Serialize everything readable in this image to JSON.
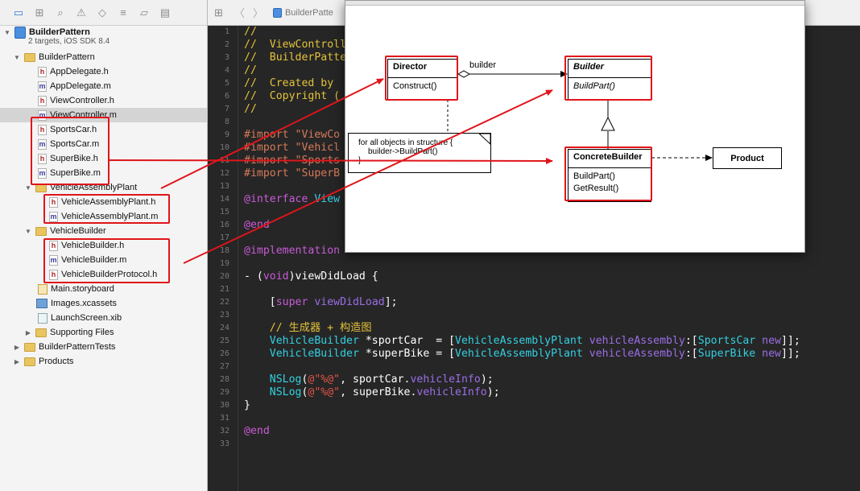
{
  "navigator": {
    "toolbar_icons": [
      "folder-icon",
      "symbol-icon",
      "search-icon",
      "warning-icon",
      "test-icon",
      "debug-icon",
      "breakpoint-icon",
      "log-icon"
    ],
    "project": {
      "name": "BuilderPattern",
      "subtitle": "2 targets, iOS SDK 8.4"
    },
    "items": [
      {
        "label": "BuilderPattern",
        "kind": "group"
      },
      {
        "label": "AppDelegate.h",
        "kind": "h"
      },
      {
        "label": "AppDelegate.m",
        "kind": "m"
      },
      {
        "label": "ViewController.h",
        "kind": "h"
      },
      {
        "label": "ViewController.m",
        "kind": "m"
      },
      {
        "label": "SportsCar.h",
        "kind": "h"
      },
      {
        "label": "SportsCar.m",
        "kind": "m"
      },
      {
        "label": "SuperBike.h",
        "kind": "h"
      },
      {
        "label": "SuperBike.m",
        "kind": "m"
      },
      {
        "label": "VehicleAssemblyPlant",
        "kind": "group"
      },
      {
        "label": "VehicleAssemblyPlant.h",
        "kind": "h"
      },
      {
        "label": "VehicleAssemblyPlant.m",
        "kind": "m"
      },
      {
        "label": "VehicleBuilder",
        "kind": "group"
      },
      {
        "label": "VehicleBuilder.h",
        "kind": "h"
      },
      {
        "label": "VehicleBuilder.m",
        "kind": "m"
      },
      {
        "label": "VehicleBuilderProtocol.h",
        "kind": "h"
      },
      {
        "label": "Main.storyboard",
        "kind": "storyboard"
      },
      {
        "label": "Images.xcassets",
        "kind": "xcassets"
      },
      {
        "label": "LaunchScreen.xib",
        "kind": "xib"
      },
      {
        "label": "Supporting Files",
        "kind": "group"
      },
      {
        "label": "BuilderPatternTests",
        "kind": "group"
      },
      {
        "label": "Products",
        "kind": "group"
      }
    ]
  },
  "editor": {
    "breadcrumb": "BuilderPatte",
    "line_numbers": [
      "1",
      "2",
      "3",
      "4",
      "5",
      "6",
      "7",
      "8",
      "9",
      "10",
      "11",
      "12",
      "13",
      "14",
      "15",
      "16",
      "17",
      "18",
      "19",
      "20",
      "21",
      "22",
      "23",
      "24",
      "25",
      "26",
      "27",
      "28",
      "29",
      "30",
      "31",
      "32",
      "33"
    ],
    "code": {
      "l1": "//",
      "l2": "//  ViewControll",
      "l3": "//  BuilderPatte",
      "l4": "//",
      "l5": "//  Created by",
      "l6": "//  Copyright (",
      "l7": "//",
      "l9": "#import \"ViewCo",
      "l10": "#import \"Vehicl",
      "l11": "#import \"Sports",
      "l12": "#import \"SuperB",
      "l14a": "@interface",
      "l14b": " View",
      "l16": "@end",
      "l18a": "@implementation",
      "l20a": "- (",
      "l20b": "void",
      "l20c": ")viewDidLoad {",
      "l22a": "    [",
      "l22b": "super",
      "l22c": " ",
      "l22d": "viewDidLoad",
      "l22e": "];",
      "l24": "    // 生成器 + 构造图",
      "l25a": "    VehicleBuilder",
      "l25b": " *sportCar  = [",
      "l25c": "VehicleAssemblyPlant",
      "l25d": " vehicleAssembly",
      "l25e": ":[",
      "l25f": "SportsCar",
      "l25g": " new",
      "l25h": "]];",
      "l26a": "    VehicleBuilder",
      "l26b": " *superBike = [",
      "l26c": "VehicleAssemblyPlant",
      "l26d": " vehicleAssembly",
      "l26e": ":[",
      "l26f": "SuperBike",
      "l26g": " new",
      "l26h": "]];",
      "l28a": "    NSLog",
      "l28b": "(",
      "l28c": "@\"%@\"",
      "l28d": ", sportCar.",
      "l28e": "vehicleInfo",
      "l28f": ");",
      "l29a": "    NSLog",
      "l29b": "(",
      "l29c": "@\"%@\"",
      "l29d": ", superBike.",
      "l29e": "vehicleInfo",
      "l29f": ");",
      "l30": "}",
      "l32": "@end"
    }
  },
  "diagram": {
    "director": {
      "name": "Director",
      "method": "Construct()"
    },
    "builder": {
      "name": "Builder",
      "method": "BuildPart()"
    },
    "concrete": {
      "name": "ConcreteBuilder",
      "method1": "BuildPart()",
      "method2": "GetResult()"
    },
    "product": {
      "name": "Product"
    },
    "association_label": "builder",
    "note": {
      "line1": "for all objects in structure {",
      "line2": "builder->BuildPart()",
      "line3": "}"
    }
  },
  "colors": {
    "highlight": "#e0151a",
    "comment": "#e4c23a",
    "keyword": "#c85bd6",
    "type": "#33d0e0",
    "string": "#e05545",
    "method": "#9b6ee6"
  }
}
